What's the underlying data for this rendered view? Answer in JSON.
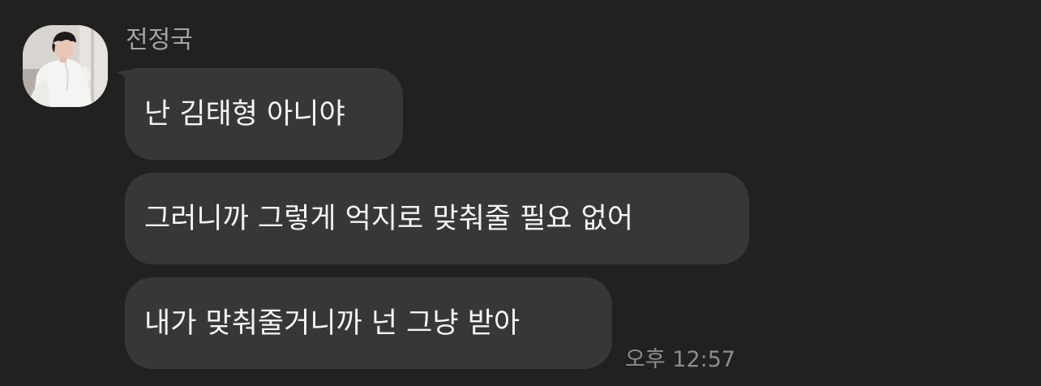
{
  "chat": {
    "sender": {
      "name": "전정국",
      "avatar_icon": "profile-photo-avatar"
    },
    "messages": [
      {
        "text": "난 김태형 아니야"
      },
      {
        "text": "그러니까 그렇게 억지로 맞춰줄 필요 없어"
      },
      {
        "text": "내가 맞춰줄거니까 넌 그냥 받아"
      }
    ],
    "timestamp": "오후 12:57"
  },
  "theme": {
    "background": "#212121",
    "bubble": "#373737",
    "message_text": "#f4f4f4",
    "name_text": "#a5a5a5",
    "timestamp_text": "#8c8c8c"
  }
}
